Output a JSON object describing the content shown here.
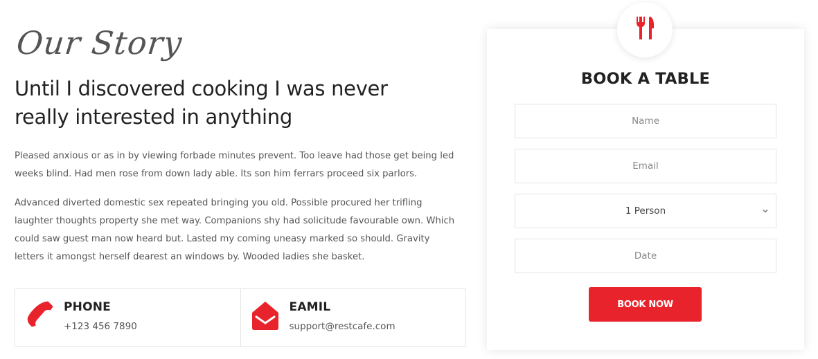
{
  "story": {
    "script_title": "Our Story",
    "headline": "Until I discovered cooking I was never really interested in anything",
    "paragraph1": "Pleased anxious or as in by viewing forbade minutes prevent. Too leave had those get being led weeks blind. Had men rose from down lady able. Its son him ferrars proceed six parlors.",
    "paragraph2": "Advanced diverted domestic sex repeated bringing you old. Possible procured her trifling laughter thoughts property she met way. Companions shy had solicitude favourable own. Which could saw guest man now heard but. Lasted my coming uneasy marked so should. Gravity letters it amongst herself dearest an windows by. Wooded ladies she basket."
  },
  "contact": {
    "phone": {
      "icon": "phone-icon",
      "label": "PHONE",
      "value": "+123 456 7890"
    },
    "email": {
      "icon": "envelope-icon",
      "label": "EAMIL",
      "value": "support@restcafe.com"
    }
  },
  "booking": {
    "icon": "fork-knife-icon",
    "title": "BOOK A TABLE",
    "name_placeholder": "Name",
    "email_placeholder": "Email",
    "persons_selected": "1 Person",
    "date_placeholder": "Date",
    "button_label": "BOOK NOW"
  },
  "colors": {
    "accent": "#e8232c",
    "text_dark": "#222222",
    "text_body": "#555555",
    "border": "#e5e5e5"
  }
}
